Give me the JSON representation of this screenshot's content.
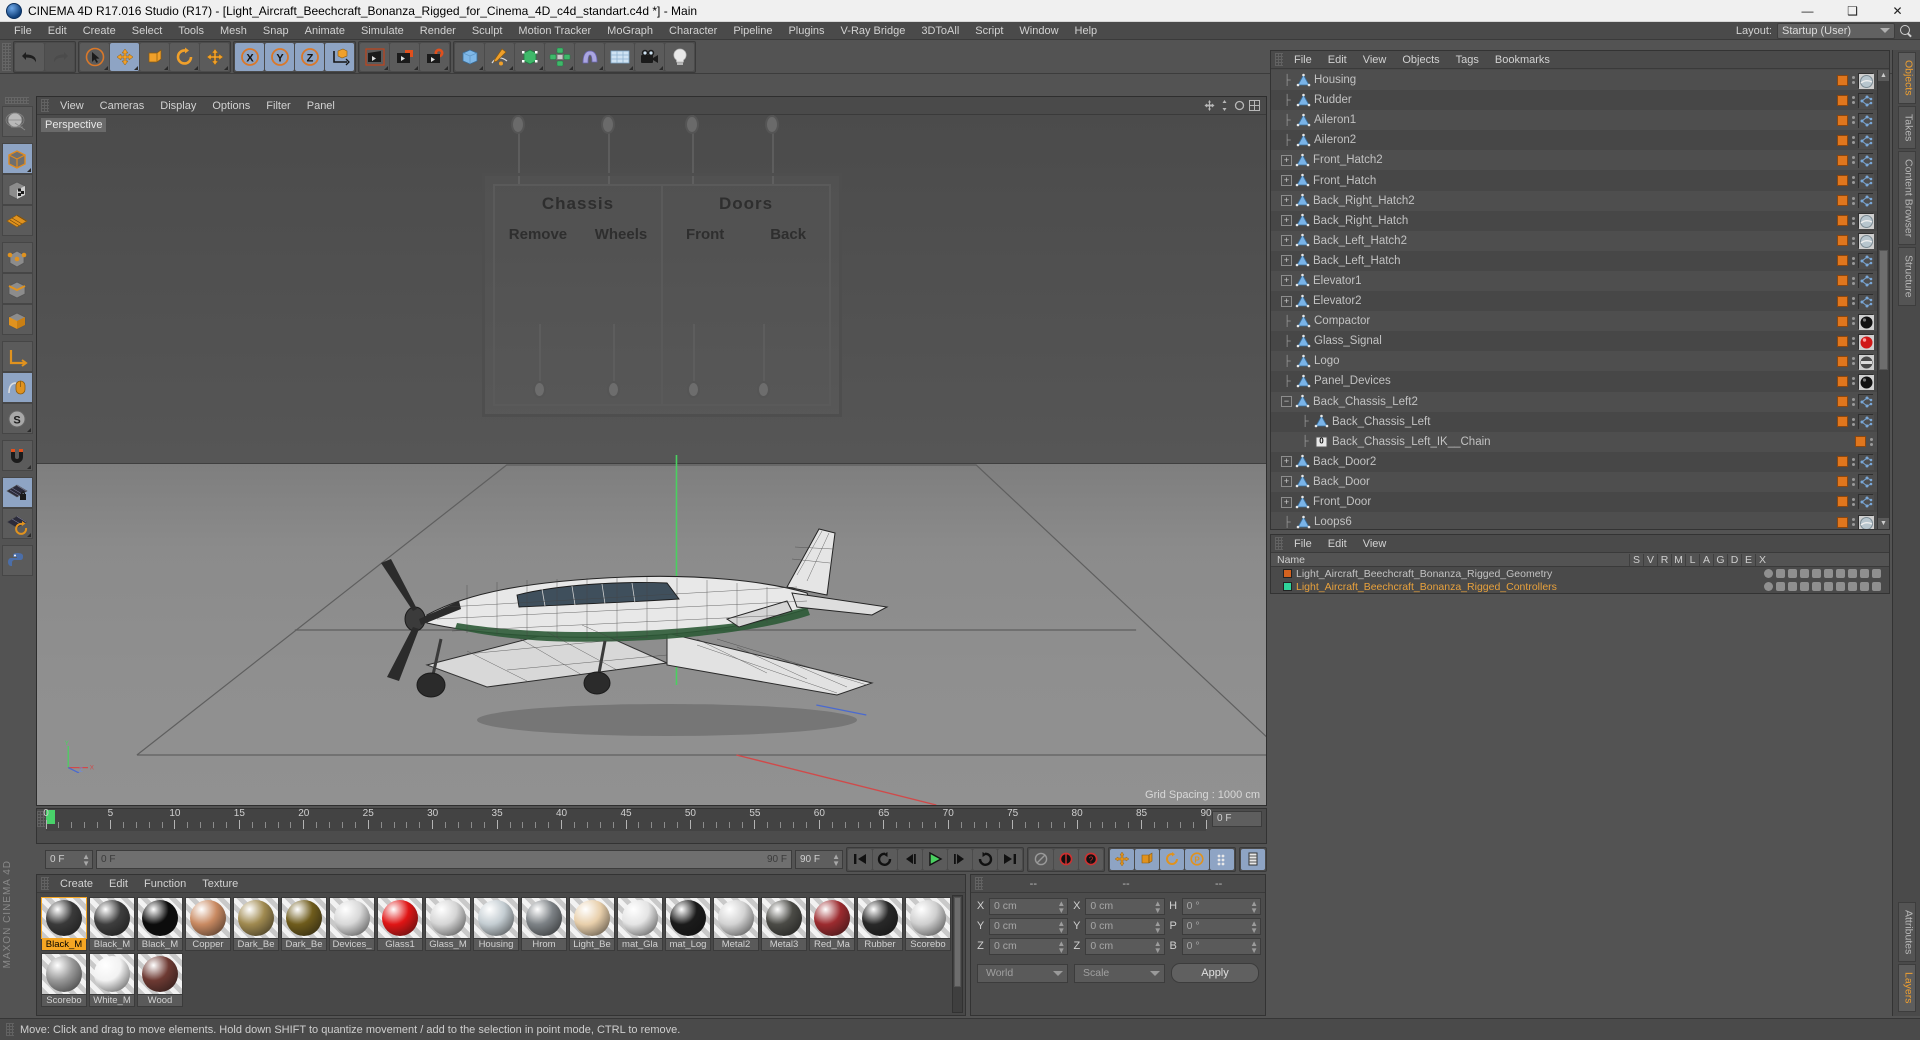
{
  "titlebar": {
    "title": "CINEMA 4D R17.016 Studio (R17) - [Light_Aircraft_Beechcraft_Bonanza_Rigged_for_Cinema_4D_c4d_standart.c4d *] - Main",
    "minimize": "—",
    "maximize": "❑",
    "close": "✕"
  },
  "menubar": {
    "items": [
      "File",
      "Edit",
      "Create",
      "Select",
      "Tools",
      "Mesh",
      "Snap",
      "Animate",
      "Simulate",
      "Render",
      "Sculpt",
      "Motion Tracker",
      "MoGraph",
      "Character",
      "Pipeline",
      "Plugins",
      "V-Ray Bridge",
      "3DToAll",
      "Script",
      "Window",
      "Help"
    ],
    "layout_label": "Layout:",
    "layout_value": "Startup (User)"
  },
  "viewport": {
    "menus": [
      "View",
      "Cameras",
      "Display",
      "Options",
      "Filter",
      "Panel"
    ],
    "label": "Perspective",
    "grid_spacing": "Grid Spacing : 1000 cm",
    "billboard": {
      "left_title": "Chassis",
      "left_options": [
        "Remove",
        "Wheels"
      ],
      "right_title": "Doors",
      "right_options": [
        "Front",
        "Back"
      ]
    }
  },
  "timeline": {
    "ticks": [
      0,
      5,
      10,
      15,
      20,
      25,
      30,
      35,
      40,
      45,
      50,
      55,
      60,
      65,
      70,
      75,
      80,
      85,
      90
    ],
    "current_frame_field": "0 F",
    "start_field": "0 F",
    "range_start": "0 F",
    "range_end": "90 F",
    "end_field": "90 F"
  },
  "material_manager": {
    "menus": [
      "Create",
      "Edit",
      "Function",
      "Texture"
    ],
    "materials": [
      {
        "name": "Black_M",
        "color": "#3a3a3a",
        "selected": true
      },
      {
        "name": "Black_M",
        "color": "#3e3e3e",
        "selected": false
      },
      {
        "name": "Black_M",
        "color": "#0c0c0c",
        "selected": false
      },
      {
        "name": "Copper",
        "color": "#c98a62",
        "selected": false
      },
      {
        "name": "Dark_Be",
        "color": "#a08a50",
        "selected": false
      },
      {
        "name": "Dark_Be",
        "color": "#6f5c1c",
        "selected": false
      },
      {
        "name": "Devices_",
        "color": "#d8d8d8",
        "selected": false
      },
      {
        "name": "Glass1",
        "color": "#e01515",
        "selected": false
      },
      {
        "name": "Glass_M",
        "color": "#d5d5d5",
        "selected": false
      },
      {
        "name": "Housing",
        "color": "#c4cdd2",
        "selected": false
      },
      {
        "name": "Hrom",
        "color": "#7d8286",
        "selected": false
      },
      {
        "name": "Light_Be",
        "color": "#e8cfab",
        "selected": false
      },
      {
        "name": "mat_Gla",
        "color": "#e4e4e4",
        "selected": false
      },
      {
        "name": "mat_Log",
        "color": "#1b1b1b",
        "selected": false
      },
      {
        "name": "Metal2",
        "color": "#d3d3d3",
        "selected": false
      },
      {
        "name": "Metal3",
        "color": "#4b4b46",
        "selected": false
      },
      {
        "name": "Red_Ma",
        "color": "#9c2b2f",
        "selected": false
      },
      {
        "name": "Rubber",
        "color": "#282828",
        "selected": false
      },
      {
        "name": "Scorebo",
        "color": "#cfcfcf",
        "selected": false
      },
      {
        "name": "Scorebo",
        "color": "#9a9a9a",
        "selected": false
      },
      {
        "name": "White_M",
        "color": "#f2f2f2",
        "selected": false
      },
      {
        "name": "Wood",
        "color": "#6e3a33",
        "selected": false
      }
    ]
  },
  "coordinates": {
    "header": [
      "--",
      "--",
      "--"
    ],
    "rows": [
      {
        "pos_label": "X",
        "pos_value": "0 cm",
        "size_label": "X",
        "size_value": "0 cm",
        "rot_label": "H",
        "rot_value": "0 °"
      },
      {
        "pos_label": "Y",
        "pos_value": "0 cm",
        "size_label": "Y",
        "size_value": "0 cm",
        "rot_label": "P",
        "rot_value": "0 °"
      },
      {
        "pos_label": "Z",
        "pos_value": "0 cm",
        "size_label": "Z",
        "size_value": "0 cm",
        "rot_label": "B",
        "rot_value": "0 °"
      }
    ],
    "system": "World",
    "mode": "Scale",
    "apply": "Apply"
  },
  "object_manager": {
    "menus": [
      "File",
      "Edit",
      "View",
      "Objects",
      "Tags",
      "Bookmarks"
    ],
    "objects": [
      {
        "name": "Housing",
        "depth": 1,
        "expander": "none",
        "icon": "polygon-object-icon",
        "tag": "material-ball"
      },
      {
        "name": "Rudder",
        "depth": 1,
        "expander": "none",
        "icon": "polygon-object-icon",
        "tag": "point-cluster"
      },
      {
        "name": "Aileron1",
        "depth": 1,
        "expander": "none",
        "icon": "polygon-object-icon",
        "tag": "point-cluster"
      },
      {
        "name": "Aileron2",
        "depth": 1,
        "expander": "none",
        "icon": "polygon-object-icon",
        "tag": "point-cluster"
      },
      {
        "name": "Front_Hatch2",
        "depth": 1,
        "expander": "plus",
        "icon": "polygon-object-icon",
        "tag": "point-cluster"
      },
      {
        "name": "Front_Hatch",
        "depth": 1,
        "expander": "plus",
        "icon": "polygon-object-icon",
        "tag": "point-cluster"
      },
      {
        "name": "Back_Right_Hatch2",
        "depth": 1,
        "expander": "plus",
        "icon": "polygon-object-icon",
        "tag": "point-cluster"
      },
      {
        "name": "Back_Right_Hatch",
        "depth": 1,
        "expander": "plus",
        "icon": "polygon-object-icon",
        "tag": "material-ball"
      },
      {
        "name": "Back_Left_Hatch2",
        "depth": 1,
        "expander": "plus",
        "icon": "polygon-object-icon",
        "tag": "material-ball"
      },
      {
        "name": "Back_Left_Hatch",
        "depth": 1,
        "expander": "plus",
        "icon": "polygon-object-icon",
        "tag": "point-cluster"
      },
      {
        "name": "Elevator1",
        "depth": 1,
        "expander": "plus",
        "icon": "polygon-object-icon",
        "tag": "point-cluster"
      },
      {
        "name": "Elevator2",
        "depth": 1,
        "expander": "plus",
        "icon": "polygon-object-icon",
        "tag": "point-cluster"
      },
      {
        "name": "Compactor",
        "depth": 1,
        "expander": "none",
        "icon": "polygon-object-icon",
        "tag": "black-ball"
      },
      {
        "name": "Glass_Signal",
        "depth": 1,
        "expander": "none",
        "icon": "polygon-object-icon",
        "tag": "red-ball"
      },
      {
        "name": "Logo",
        "depth": 1,
        "expander": "none",
        "icon": "polygon-object-icon",
        "tag": "logo-ball"
      },
      {
        "name": "Panel_Devices",
        "depth": 1,
        "expander": "none",
        "icon": "polygon-object-icon",
        "tag": "black-ball"
      },
      {
        "name": "Back_Chassis_Left2",
        "depth": 1,
        "expander": "minus",
        "icon": "polygon-object-icon",
        "tag": "point-cluster"
      },
      {
        "name": "Back_Chassis_Left",
        "depth": 2,
        "expander": "none",
        "icon": "polygon-object-icon",
        "tag": "point-cluster"
      },
      {
        "name": "Back_Chassis_Left_IK__Chain",
        "depth": 2,
        "expander": "none",
        "icon": "ik-chain-icon",
        "tag": "none"
      },
      {
        "name": "Back_Door2",
        "depth": 1,
        "expander": "plus",
        "icon": "polygon-object-icon",
        "tag": "point-cluster"
      },
      {
        "name": "Back_Door",
        "depth": 1,
        "expander": "plus",
        "icon": "polygon-object-icon",
        "tag": "point-cluster"
      },
      {
        "name": "Front_Door",
        "depth": 1,
        "expander": "plus",
        "icon": "polygon-object-icon",
        "tag": "point-cluster"
      },
      {
        "name": "Loops6",
        "depth": 1,
        "expander": "none",
        "icon": "polygon-object-icon",
        "tag": "material-ball"
      }
    ]
  },
  "layer_manager": {
    "menus": [
      "File",
      "Edit",
      "View"
    ],
    "columns": [
      "Name",
      "S",
      "V",
      "R",
      "M",
      "L",
      "A",
      "G",
      "D",
      "E",
      "X"
    ],
    "layers": [
      {
        "name": "Light_Aircraft_Beechcraft_Bonanza_Rigged_Geometry",
        "color": "#d4621f",
        "selected": false
      },
      {
        "name": "Light_Aircraft_Beechcraft_Bonanza_Rigged_Controllers",
        "color": "#2fd49a",
        "selected": true
      }
    ]
  },
  "right_rail": {
    "top_tabs": [
      "Objects",
      "Takes",
      "Content Browser",
      "Structure"
    ],
    "bottom_tabs": [
      "Attributes",
      "Layers"
    ],
    "active_top": "Objects",
    "active_bottom": "Layers"
  },
  "statusbar": {
    "message": "Move: Click and drag to move elements. Hold down SHIFT to quantize movement / add to the selection in point mode, CTRL to remove."
  },
  "branding": {
    "text": "MAXON CINEMA 4D"
  },
  "toolbar": {
    "groups": [
      {
        "buttons": [
          {
            "name": "undo-button",
            "active": false
          },
          {
            "name": "redo-button",
            "active": false,
            "dim": true
          }
        ]
      },
      {
        "buttons": [
          {
            "name": "select-tool-button",
            "active": false
          },
          {
            "name": "move-tool-button",
            "active": true
          },
          {
            "name": "scale-tool-button",
            "active": false
          },
          {
            "name": "rotate-tool-button",
            "active": false
          },
          {
            "name": "move-axis-button",
            "active": false
          }
        ]
      },
      {
        "buttons": [
          {
            "name": "x-axis-lock-button",
            "active": true
          },
          {
            "name": "y-axis-lock-button",
            "active": true
          },
          {
            "name": "z-axis-lock-button",
            "active": true
          },
          {
            "name": "world-object-coord-button",
            "active": false
          }
        ]
      },
      {
        "buttons": [
          {
            "name": "render-view-button",
            "active": false
          },
          {
            "name": "render-region-button",
            "active": false
          },
          {
            "name": "render-settings-button",
            "active": false
          }
        ]
      },
      {
        "buttons": [
          {
            "name": "cube-primitive-button",
            "active": false
          },
          {
            "name": "spline-pen-button",
            "active": false
          },
          {
            "name": "nurbs-generator-button",
            "active": false
          },
          {
            "name": "array-modeling-button",
            "active": false
          },
          {
            "name": "bend-deformer-button",
            "active": false
          },
          {
            "name": "floor-scene-button",
            "active": false
          },
          {
            "name": "camera-button",
            "active": false
          },
          {
            "name": "light-button",
            "active": false
          }
        ]
      }
    ]
  },
  "left_toolbar": {
    "buttons": [
      {
        "name": "make-editable-button",
        "active": false
      },
      {
        "name": "model-mode-button",
        "active": true
      },
      {
        "name": "texture-mode-button",
        "active": false
      },
      {
        "name": "workplane-mode-button",
        "active": false
      },
      {
        "name": "point-mode-button",
        "active": false
      },
      {
        "name": "edge-mode-button",
        "active": false
      },
      {
        "name": "polygon-mode-button",
        "active": false
      },
      {
        "name": "axis-modify-button",
        "active": false
      },
      {
        "name": "viewport-solo-button",
        "active": true
      },
      {
        "name": "snap-settings-button",
        "active": false
      },
      {
        "name": "magnet-button",
        "active": false
      },
      {
        "name": "workplane-lock-button",
        "active": true
      },
      {
        "name": "workplane-rotate-button",
        "active": false
      },
      {
        "name": "python-console-button",
        "active": false
      }
    ]
  },
  "transport": {
    "buttons": [
      "go-to-start",
      "play-backward-loop",
      "step-back",
      "play-forward",
      "step-forward",
      "loop",
      "go-to-end"
    ],
    "record_buttons": [
      "autokey-toggle",
      "record-keyframe",
      "record-settings"
    ],
    "key_buttons": [
      "position-key",
      "scale-key",
      "rotation-key",
      "pla-key",
      "param-key"
    ]
  }
}
